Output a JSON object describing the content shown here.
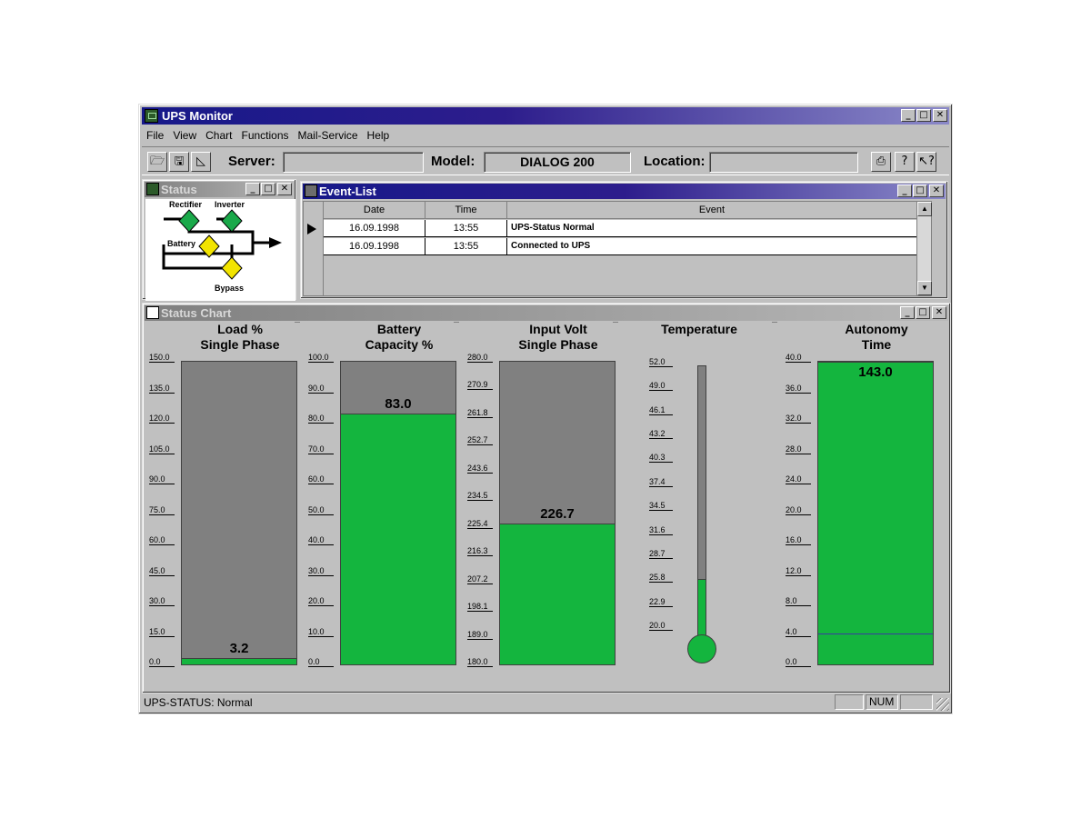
{
  "app": {
    "title": "UPS Monitor"
  },
  "menu": [
    "File",
    "View",
    "Chart",
    "Functions",
    "Mail-Service",
    "Help"
  ],
  "toolbar": {
    "server_label": "Server:",
    "server_value": "",
    "model_label": "Model:",
    "model_value": "DIALOG 200",
    "location_label": "Location:",
    "location_value": ""
  },
  "status_window": {
    "title": "Status",
    "labels": {
      "rectifier": "Rectifier",
      "inverter": "Inverter",
      "battery": "Battery",
      "bypass": "Bypass"
    },
    "colors": {
      "rectifier": "#1aa94a",
      "inverter": "#1aa94a",
      "battery": "#f2e400",
      "bypass": "#f2e400"
    }
  },
  "event_list": {
    "title": "Event-List",
    "columns": [
      "Date",
      "Time",
      "Event"
    ],
    "rows": [
      {
        "date": "16.09.1998",
        "time": "13:55",
        "event": "UPS-Status Normal"
      },
      {
        "date": "16.09.1998",
        "time": "13:55",
        "event": "Connected to UPS"
      }
    ]
  },
  "status_chart": {
    "title": "Status Chart",
    "gauges": [
      {
        "title": [
          "Load %",
          "Single Phase"
        ],
        "value_label": "3.2",
        "value": 3.2,
        "min": 0,
        "max": 150,
        "ticks": [
          "150.0",
          "135.0",
          "120.0",
          "105.0",
          "90.0",
          "75.0",
          "60.0",
          "45.0",
          "30.0",
          "15.0",
          "0.0"
        ]
      },
      {
        "title": [
          "Battery",
          "Capacity %"
        ],
        "value_label": "83.0",
        "value": 83.0,
        "min": 0,
        "max": 100,
        "ticks": [
          "100.0",
          "90.0",
          "80.0",
          "70.0",
          "60.0",
          "50.0",
          "40.0",
          "30.0",
          "20.0",
          "10.0",
          "0.0"
        ]
      },
      {
        "title": [
          "Input Volt",
          "Single Phase"
        ],
        "value_label": "226.7",
        "value": 226.7,
        "min": 180,
        "max": 280,
        "ticks": [
          "280.0",
          "270.9",
          "261.8",
          "252.7",
          "243.6",
          "234.5",
          "225.4",
          "216.3",
          "207.2",
          "198.1",
          "189.0",
          "180.0"
        ]
      },
      {
        "title": [
          "Temperature",
          ""
        ],
        "value_label": "",
        "value": 26.0,
        "min": 20,
        "max": 52,
        "ticks": [
          "52.0",
          "49.0",
          "46.1",
          "43.2",
          "40.3",
          "37.4",
          "34.5",
          "31.6",
          "28.7",
          "25.8",
          "22.9",
          "20.0"
        ]
      },
      {
        "title": [
          "Autonomy",
          "Time"
        ],
        "value_label": "143.0",
        "value": 40.0,
        "min": 0,
        "max": 40,
        "threshold": 4.0,
        "ticks": [
          "40.0",
          "36.0",
          "32.0",
          "28.0",
          "24.0",
          "20.0",
          "16.0",
          "12.0",
          "8.0",
          "4.0",
          "0.0"
        ]
      }
    ]
  },
  "statusbar": {
    "text": "UPS-STATUS:  Normal",
    "num": "NUM"
  }
}
